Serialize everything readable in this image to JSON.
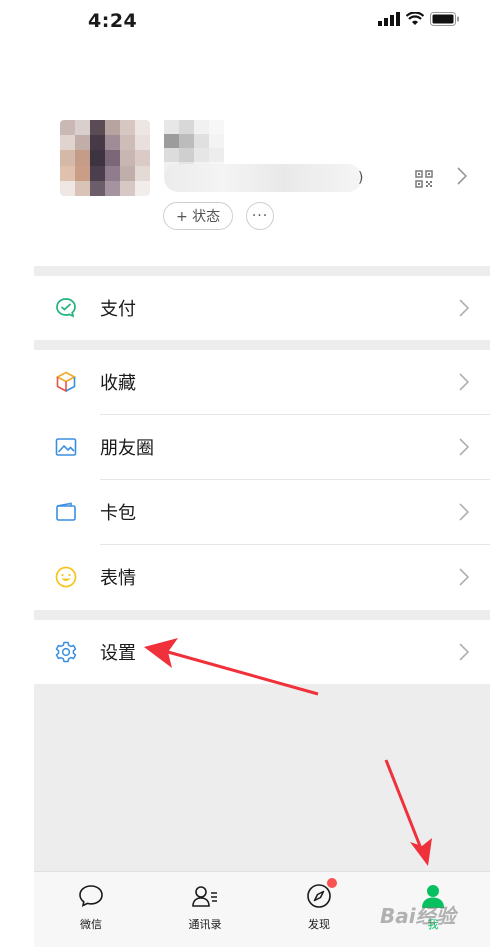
{
  "status_bar": {
    "time": "4:24"
  },
  "profile": {
    "status_button": "+ 状态",
    "more_button": "···",
    "wxid_tail": ")"
  },
  "menu": [
    {
      "label": "支付",
      "icon": "wechat-pay-icon"
    },
    {
      "label": "收藏",
      "icon": "favorites-cube-icon"
    },
    {
      "label": "朋友圈",
      "icon": "moments-photo-icon"
    },
    {
      "label": "卡包",
      "icon": "card-wallet-icon"
    },
    {
      "label": "表情",
      "icon": "emoji-smile-icon"
    },
    {
      "label": "设置",
      "icon": "settings-gear-icon"
    }
  ],
  "tabs": [
    {
      "label": "微信",
      "icon": "chat-bubble-icon",
      "active": false,
      "badge": false
    },
    {
      "label": "通讯录",
      "icon": "contacts-icon",
      "active": false,
      "badge": false
    },
    {
      "label": "发现",
      "icon": "compass-icon",
      "active": false,
      "badge": true
    },
    {
      "label": "我",
      "icon": "person-icon",
      "active": true,
      "badge": false
    }
  ],
  "watermark": "Bai经验",
  "colors": {
    "accent": "#07c160",
    "badge": "#fa5151",
    "gap": "#ededed",
    "arrow": "#f0303a"
  }
}
